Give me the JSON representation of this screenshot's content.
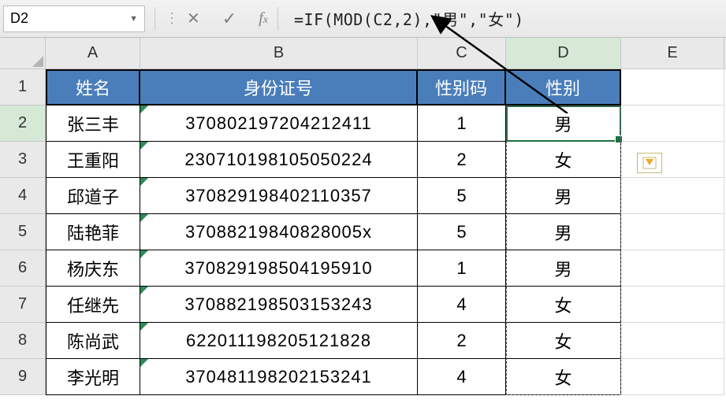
{
  "formula_bar": {
    "cell_ref": "D2",
    "formula": "=IF(MOD(C2,2),\"男\",\"女\")"
  },
  "columns": [
    "A",
    "B",
    "C",
    "D",
    "E"
  ],
  "row_numbers": [
    1,
    2,
    3,
    4,
    5,
    6,
    7,
    8,
    9
  ],
  "headers": {
    "A": "姓名",
    "B": "身份证号",
    "C": "性别码",
    "D": "性别"
  },
  "rows": [
    {
      "A": "张三丰",
      "B": "370802197204212411",
      "C": "1",
      "D": "男"
    },
    {
      "A": "王重阳",
      "B": "230710198105050224",
      "C": "2",
      "D": "女"
    },
    {
      "A": "邱道子",
      "B": "370829198402110357",
      "C": "5",
      "D": "男"
    },
    {
      "A": "陆艳菲",
      "B": "37088219840828005x",
      "C": "5",
      "D": "男"
    },
    {
      "A": "杨庆东",
      "B": "370829198504195910",
      "C": "1",
      "D": "男"
    },
    {
      "A": "任继先",
      "B": "370882198503153243",
      "C": "4",
      "D": "女"
    },
    {
      "A": "陈尚武",
      "B": "622011198205121828",
      "C": "2",
      "D": "女"
    },
    {
      "A": "李光明",
      "B": "370481198202153241",
      "C": "4",
      "D": "女"
    }
  ],
  "active_cell": "D2",
  "active_column": "D",
  "active_row": 2
}
